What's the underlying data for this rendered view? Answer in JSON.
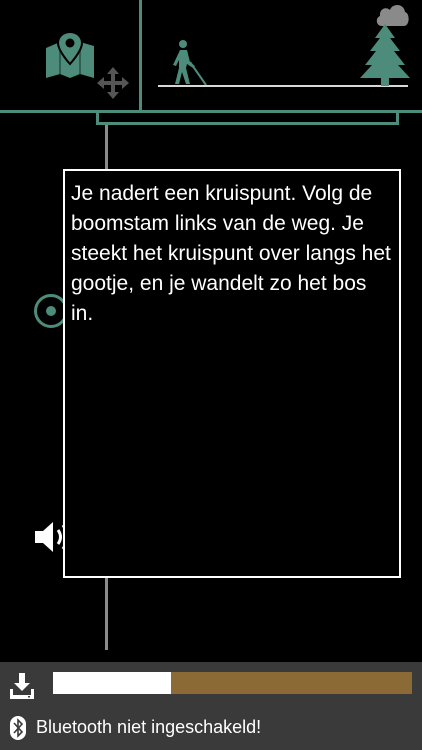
{
  "message": {
    "text": "Je nadert een kruispunt. Volg de boomstam links van de weg. Je steekt het kruispunt over langs het gootje, en je wandelt zo het bos in."
  },
  "download": {
    "progress_fraction": 0.33
  },
  "status": {
    "bluetooth": "Bluetooth niet ingeschakeld!"
  },
  "icons": {
    "map": "map-pin-icon",
    "move": "move-arrows-icon",
    "walker": "blind-walker-icon",
    "tree": "pine-tree-icon",
    "cloud": "cloud-icon",
    "speaker": "speaker-icon",
    "download": "download-icon",
    "bluetooth": "bluetooth-icon"
  },
  "colors": {
    "accent": "#4d8c7a",
    "progress_track": "#8c6a36",
    "progress_fill": "#ffffff",
    "footer_bg": "#3a3a3a"
  }
}
